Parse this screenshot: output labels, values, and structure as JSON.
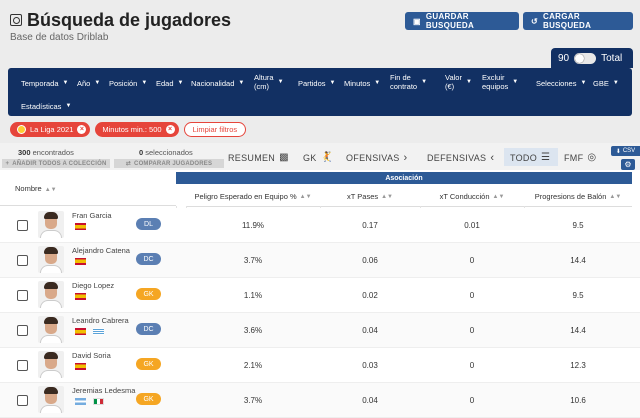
{
  "header": {
    "title": "Búsqueda de jugadores",
    "subtitle": "Base de datos Driblab",
    "save_label": "GUARDAR BUSQUEDA",
    "load_label": "CARGAR BUSQUEDA"
  },
  "total": {
    "value": "90",
    "label": "Total"
  },
  "filters": [
    "Temporada",
    "Año",
    "Posición",
    "Edad",
    "Nacionalidad",
    "Altura\n(cm)",
    "Partidos",
    "Minutos",
    "Fin de\ncontrato",
    "Valor\n(€)",
    "Excluir\nequipos",
    "Selecciones",
    "GBE",
    "Estadísticas"
  ],
  "chips": {
    "league": "La Liga 2021",
    "minutes": "Minutos min.: 500",
    "clear": "Limpiar filtros"
  },
  "counts": {
    "found_num": "300",
    "found_label": "encontrados",
    "selected_num": "0",
    "selected_label": "seleccionados",
    "add_all": "AÑADIR TODOS A COLECCIÓN",
    "compare": "COMPARAR JUGADORES"
  },
  "tabs": {
    "resumen": "RESUMEN",
    "gk": "GK",
    "ofensivas": "OFENSIVAS",
    "defensivas": "DEFENSIVAS",
    "todo": "TODO",
    "fmf": "FMF",
    "csv": "CSV"
  },
  "table": {
    "name_header": "Nombre",
    "group_header": "Asociación",
    "columns": [
      "Peligro Esperado en Equipo %",
      "xT Pases",
      "xT Conducción",
      "Progresions de Balón"
    ],
    "rows": [
      {
        "name": "Fran Garcia",
        "pos": "DL",
        "values": [
          "11.9%",
          "0.17",
          "0.01",
          "9.5"
        ]
      },
      {
        "name": "Alejandro Catena",
        "pos": "DC",
        "values": [
          "3.7%",
          "0.06",
          "0",
          "14.4"
        ]
      },
      {
        "name": "Diego Lopez",
        "pos": "GK",
        "values": [
          "1.1%",
          "0.02",
          "0",
          "9.5"
        ]
      },
      {
        "name": "Leandro Cabrera",
        "pos": "DC",
        "values": [
          "3.6%",
          "0.04",
          "0",
          "14.4"
        ]
      },
      {
        "name": "David Soria",
        "pos": "GK",
        "values": [
          "2.1%",
          "0.03",
          "0",
          "12.3"
        ]
      },
      {
        "name": "Jeremias Ledesma",
        "pos": "GK",
        "values": [
          "3.7%",
          "0.04",
          "0",
          "10.6"
        ]
      }
    ]
  },
  "colors": {
    "navy": "#123063",
    "accent": "#2d5a96",
    "chip_red": "#e6453b",
    "badge_blue": "#5b7fb3",
    "badge_orange": "#f5a623"
  }
}
